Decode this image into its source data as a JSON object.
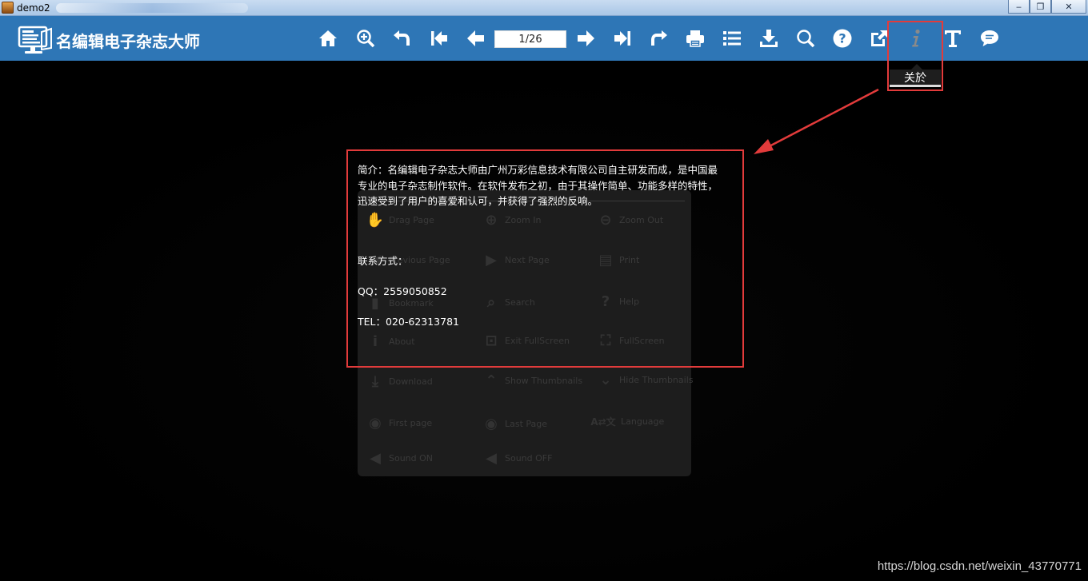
{
  "window": {
    "title": "demo2",
    "controls": {
      "minimize": "‒",
      "restore": "❐",
      "close": "✕"
    }
  },
  "toolbar": {
    "logo_text": "名编辑电子杂志大师",
    "page_indicator": "1/26",
    "buttons": [
      {
        "name": "home-button",
        "icon": "home-icon"
      },
      {
        "name": "zoom-in-button",
        "icon": "zoom-in-icon"
      },
      {
        "name": "undo-button",
        "icon": "undo-icon"
      },
      {
        "name": "first-page-button",
        "icon": "first-page-icon"
      },
      {
        "name": "previous-page-button",
        "icon": "arrow-left-icon"
      },
      {
        "name": "next-page-button",
        "icon": "arrow-right-icon"
      },
      {
        "name": "last-page-button",
        "icon": "last-page-icon"
      },
      {
        "name": "share-button",
        "icon": "share-icon"
      },
      {
        "name": "print-button",
        "icon": "print-icon"
      },
      {
        "name": "list-button",
        "icon": "list-icon"
      },
      {
        "name": "download-button",
        "icon": "download-icon"
      },
      {
        "name": "search-button",
        "icon": "search-icon"
      },
      {
        "name": "help-button",
        "icon": "help-icon"
      },
      {
        "name": "export-button",
        "icon": "export-icon"
      },
      {
        "name": "about-button",
        "icon": "info-icon"
      },
      {
        "name": "text-button",
        "icon": "text-icon"
      },
      {
        "name": "comment-button",
        "icon": "comment-icon"
      }
    ],
    "tooltip": "关於"
  },
  "about": {
    "intro": "简介：名编辑电子杂志大师由广州万彩信息技术有限公司自主研发而成，是中国最专业的电子杂志制作软件。在软件发布之初，由于其操作简单、功能多样的特性，迅速受到了用户的喜爱和认可，并获得了强烈的反响。",
    "contact_label": "联系方式：",
    "qq": "QQ：2559050852",
    "tel": "TEL：020-62313781"
  },
  "help_panel": {
    "items": [
      "Drag Page",
      "Zoom In",
      "Zoom Out",
      "Previous Page",
      "Next Page",
      "Print",
      "Bookmark",
      "Search",
      "Help",
      "About",
      "Exit FullScreen",
      "FullScreen",
      "Download",
      "Show Thumbnails",
      "Hide Thumbnails",
      "First page",
      "Last Page",
      "Language",
      "Sound ON",
      "Sound OFF"
    ]
  },
  "watermark": "https://blog.csdn.net/weixin_43770771",
  "colors": {
    "toolbar": "#2e76b6",
    "highlight": "#e23b3b",
    "background": "#000000"
  }
}
